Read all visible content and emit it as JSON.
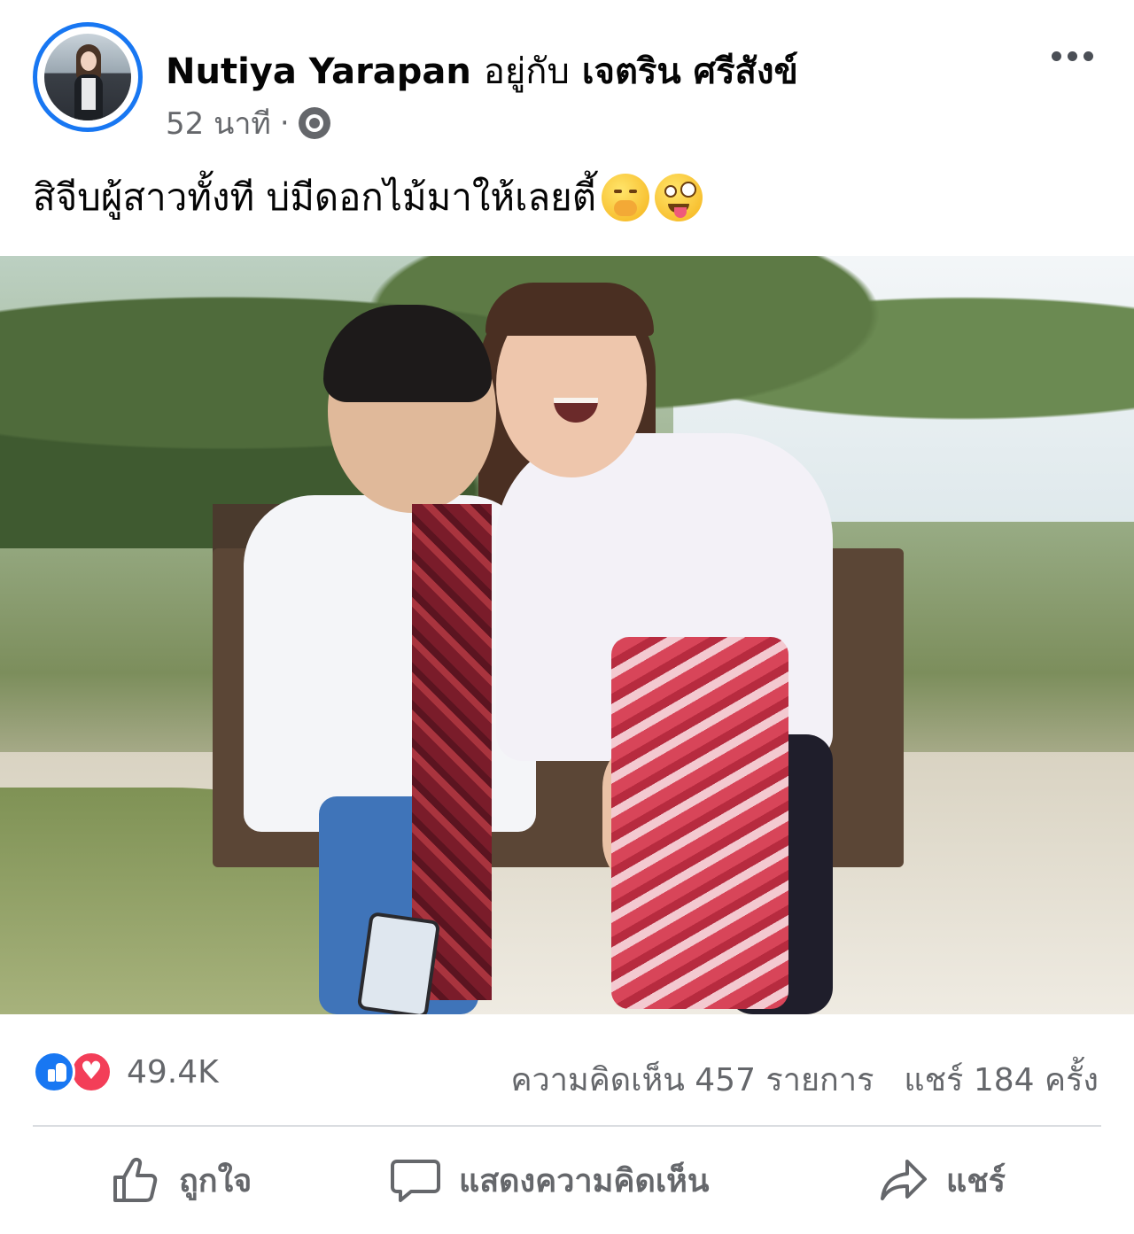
{
  "post": {
    "author": "Nutiya Yarapan",
    "with_text": "อยู่กับ",
    "tagged": "เจตริน ศรีสังข์",
    "time": "52 นาที",
    "separator": "·",
    "privacy_icon": "globe-icon",
    "more_icon": "more-options-icon",
    "caption": "สิจีบผู้สาวทั้งที บ่มีดอกไม้มาให้เลยตี้",
    "caption_emojis": [
      "yawning-face-emoji",
      "zany-face-emoji"
    ]
  },
  "stats": {
    "reaction_icons": [
      "like-reaction-icon",
      "love-reaction-icon"
    ],
    "reaction_count": "49.4K",
    "comments": "ความคิดเห็น 457 รายการ",
    "shares": "แชร์ 184 ครั้ง"
  },
  "actions": {
    "like_label": "ถูกใจ",
    "comment_label": "แสดงความคิดเห็น",
    "share_label": "แชร์"
  },
  "colors": {
    "accent": "#1877f2",
    "love": "#f33e58",
    "secondary_text": "#65676b",
    "divider": "#dadde1"
  }
}
